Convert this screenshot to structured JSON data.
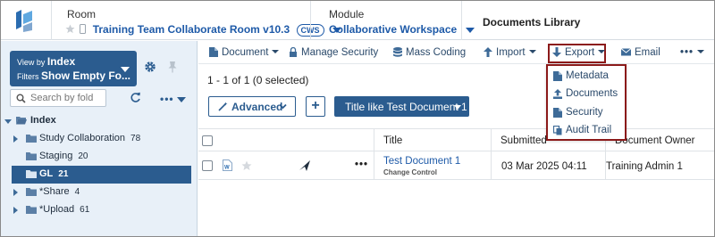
{
  "header": {
    "room": {
      "title": "Room",
      "value": "Training Team Collaborate Room v10.3",
      "badge": "CWS"
    },
    "module": {
      "title": "Module",
      "value": "Collaborative Workspace"
    },
    "page_title": "Documents Library"
  },
  "sidebar": {
    "view_by_label": "View by",
    "view_by_value": "Index",
    "filters_label": "Filters",
    "filters_value": "Show Empty Fo...",
    "search_placeholder": "Search by fold",
    "tree": [
      {
        "label": "Index",
        "count": ""
      },
      {
        "label": "Study Collaboration",
        "count": "78"
      },
      {
        "label": "Staging",
        "count": "20"
      },
      {
        "label": "GL",
        "count": "21"
      },
      {
        "label": "*Share",
        "count": "4"
      },
      {
        "label": "*Upload",
        "count": "61"
      }
    ],
    "more_label": "•••"
  },
  "toolbar": {
    "document": "Document",
    "manage_security": "Manage Security",
    "mass_coding": "Mass Coding",
    "import": "Import",
    "export": "Export",
    "email": "Email",
    "more": "•••"
  },
  "selection_count": "1 - 1 of 1 (0 selected)",
  "advanced_label": "Advanced",
  "add_label": "+",
  "filter_chip": "Title like Test Document 1",
  "grid": {
    "columns": {
      "title": "Title",
      "submitted": "Submitted",
      "owner": "Document Owner"
    },
    "rows": [
      {
        "more": "•••",
        "title": "Test Document 1",
        "subtitle": "Change Control",
        "submitted": "03 Mar 2025 04:11",
        "owner": "Training Admin 1"
      }
    ]
  },
  "export_menu": {
    "items": [
      {
        "label": "Metadata",
        "icon": "file-icon"
      },
      {
        "label": "Documents",
        "icon": "upload-icon"
      },
      {
        "label": "Security",
        "icon": "file-icon"
      },
      {
        "label": "Audit Trail",
        "icon": "copy-icon"
      }
    ]
  },
  "colors": {
    "brand": "#2b5c8f",
    "link": "#1e5aa8",
    "highlight_border": "#8b1a1a",
    "sidebar_bg": "#e8f0f8"
  }
}
